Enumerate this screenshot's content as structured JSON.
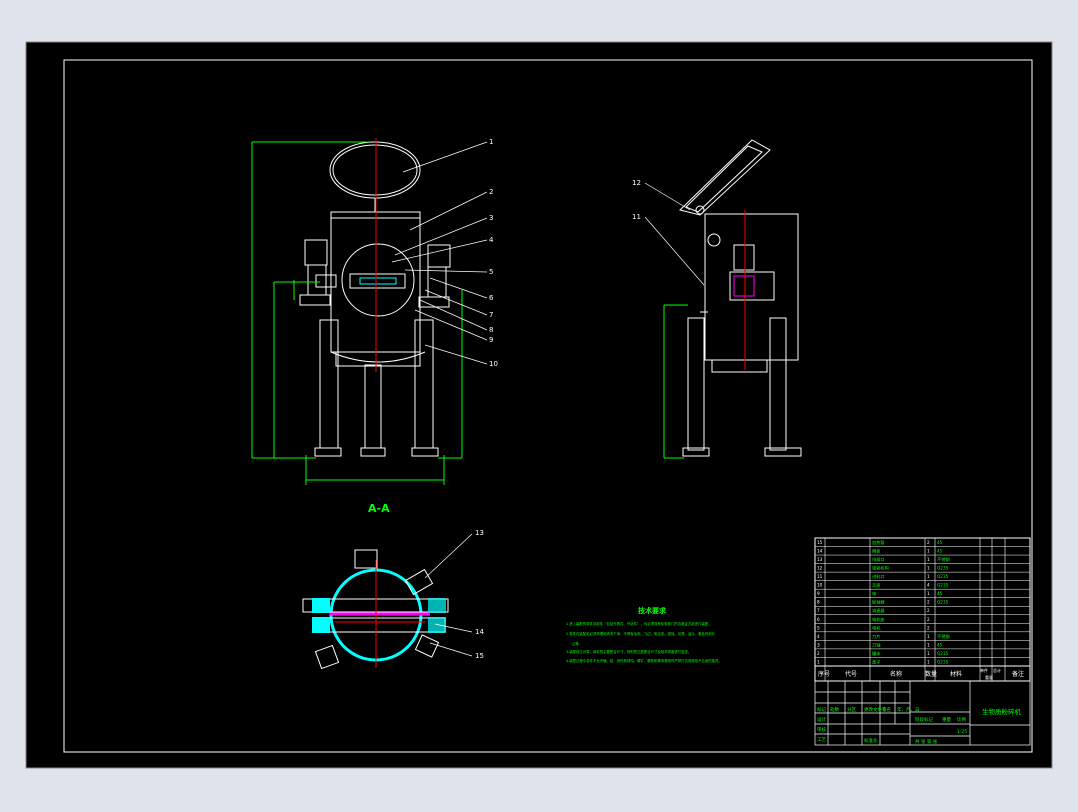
{
  "drawing": {
    "section_label": "A-A",
    "colors": {
      "background": "#dee3ec",
      "sheet": "#000000",
      "outline": "#ffffff",
      "dimension": "#00ff00",
      "centerline": "#ff0000",
      "hatch": "#00ffff",
      "section_line": "#ff00ff",
      "note_text": "#00ff00"
    },
    "front_view": {
      "balloons": [
        "1",
        "2",
        "3",
        "4",
        "5",
        "6",
        "7",
        "8",
        "9",
        "10"
      ]
    },
    "side_view": {
      "balloons": [
        "12",
        "11"
      ]
    },
    "section_view": {
      "balloons": [
        "13",
        "14",
        "15"
      ]
    },
    "technical_requirements": {
      "title": "技术要求",
      "lines": [
        "1.进入装配的零件及部件（包括外购件、外协件），均必须具有检验部门的合格证方能进行装配。",
        "2.零件在装配前必须清理和清洗干净，不得有毛刺、飞边、氧化皮、锈蚀、切屑、油污、着色剂和灰",
        "尘等。",
        "3.装配前应对零、部件的主要配合尺寸，特别是过盈配合尺寸及相关精度进行复查。",
        "4.装配过程中零件不允许磕、碰、划伤和锈蚀。螺钉、螺栓和螺母紧固时严禁打击或使用不合适的旋具。"
      ]
    },
    "parts_list": {
      "rows": [
        {
          "no": "15",
          "name": "加热管",
          "qty": "2",
          "material": "45"
        },
        {
          "no": "14",
          "name": "隔板",
          "qty": "1",
          "material": "45"
        },
        {
          "no": "13",
          "name": "排屑口",
          "qty": "1",
          "material": "不锈钢"
        },
        {
          "no": "12",
          "name": "锁紧机构",
          "qty": "1",
          "material": "Q235"
        },
        {
          "no": "11",
          "name": "进料口",
          "qty": "1",
          "material": "Q235"
        },
        {
          "no": "10",
          "name": "支座",
          "qty": "4",
          "material": "Q235"
        },
        {
          "no": "9",
          "name": "轴",
          "qty": "1",
          "material": "45"
        },
        {
          "no": "8",
          "name": "联轴器",
          "qty": "2",
          "material": "Q235"
        },
        {
          "no": "7",
          "name": "减速器",
          "qty": "2",
          "material": ""
        },
        {
          "no": "6",
          "name": "电机座",
          "qty": "2",
          "material": ""
        },
        {
          "no": "5",
          "name": "电机",
          "qty": "2",
          "material": ""
        },
        {
          "no": "4",
          "name": "刀片",
          "qty": "1",
          "material": "不锈钢"
        },
        {
          "no": "3",
          "name": "刀轴",
          "qty": "1",
          "material": "45"
        },
        {
          "no": "2",
          "name": "罐体",
          "qty": "1",
          "material": "Q235"
        },
        {
          "no": "1",
          "name": "盖子",
          "qty": "1",
          "material": "Q235"
        }
      ],
      "header": {
        "no": "序号",
        "code": "代号",
        "name": "名称",
        "qty": "数量",
        "material": "材料",
        "unit_weight": "单件",
        "total_weight": "总计",
        "weight": "重量",
        "remark": "备注"
      }
    },
    "title_block": {
      "drawing_title": "生物质粉碎机",
      "scale": "1:25",
      "sheet": "共  张  第  张",
      "rows": [
        "标记",
        "设计",
        "审核",
        "工艺",
        "批准"
      ],
      "cols": [
        "处数",
        "分区",
        "更改文件号",
        "签名",
        "年、月、日"
      ],
      "stage_label": "阶段标记",
      "weight_label": "重量",
      "scale_label": "比例",
      "std_label": "标准化"
    }
  }
}
